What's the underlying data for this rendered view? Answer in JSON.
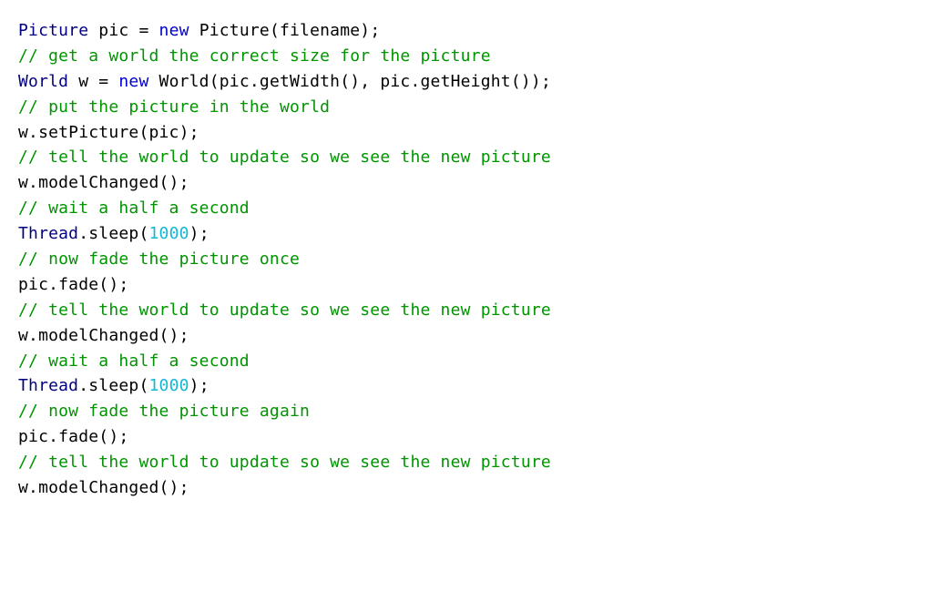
{
  "code": {
    "tokens": [
      {
        "cls": "t-type",
        "text": "Picture"
      },
      {
        "cls": "t-default",
        "text": " pic = "
      },
      {
        "cls": "t-keyword",
        "text": "new"
      },
      {
        "cls": "t-default",
        "text": " Picture(filename);\n"
      },
      {
        "cls": "t-comment",
        "text": "// get a world the correct size for the picture"
      },
      {
        "cls": "t-default",
        "text": "\n"
      },
      {
        "cls": "t-type",
        "text": "World"
      },
      {
        "cls": "t-default",
        "text": " w = "
      },
      {
        "cls": "t-keyword",
        "text": "new"
      },
      {
        "cls": "t-default",
        "text": " World(pic.getWidth(), pic.getHeight());\n"
      },
      {
        "cls": "t-comment",
        "text": "// put the picture in the world"
      },
      {
        "cls": "t-default",
        "text": "\nw.setPicture(pic);\n"
      },
      {
        "cls": "t-comment",
        "text": "// tell the world to update so we see the new picture"
      },
      {
        "cls": "t-default",
        "text": "\nw.modelChanged();\n"
      },
      {
        "cls": "t-comment",
        "text": "// wait a half a second"
      },
      {
        "cls": "t-default",
        "text": "\n"
      },
      {
        "cls": "t-type",
        "text": "Thread"
      },
      {
        "cls": "t-default",
        "text": ".sleep("
      },
      {
        "cls": "t-number",
        "text": "1000"
      },
      {
        "cls": "t-default",
        "text": ");\n"
      },
      {
        "cls": "t-comment",
        "text": "// now fade the picture once"
      },
      {
        "cls": "t-default",
        "text": "\npic.fade();\n"
      },
      {
        "cls": "t-comment",
        "text": "// tell the world to update so we see the new picture"
      },
      {
        "cls": "t-default",
        "text": "\nw.modelChanged();\n"
      },
      {
        "cls": "t-comment",
        "text": "// wait a half a second"
      },
      {
        "cls": "t-default",
        "text": "\n"
      },
      {
        "cls": "t-type",
        "text": "Thread"
      },
      {
        "cls": "t-default",
        "text": ".sleep("
      },
      {
        "cls": "t-number",
        "text": "1000"
      },
      {
        "cls": "t-default",
        "text": ");\n"
      },
      {
        "cls": "t-comment",
        "text": "// now fade the picture again"
      },
      {
        "cls": "t-default",
        "text": "\npic.fade();\n"
      },
      {
        "cls": "t-comment",
        "text": "// tell the world to update so we see the new picture"
      },
      {
        "cls": "t-default",
        "text": "\nw.modelChanged();"
      }
    ]
  }
}
